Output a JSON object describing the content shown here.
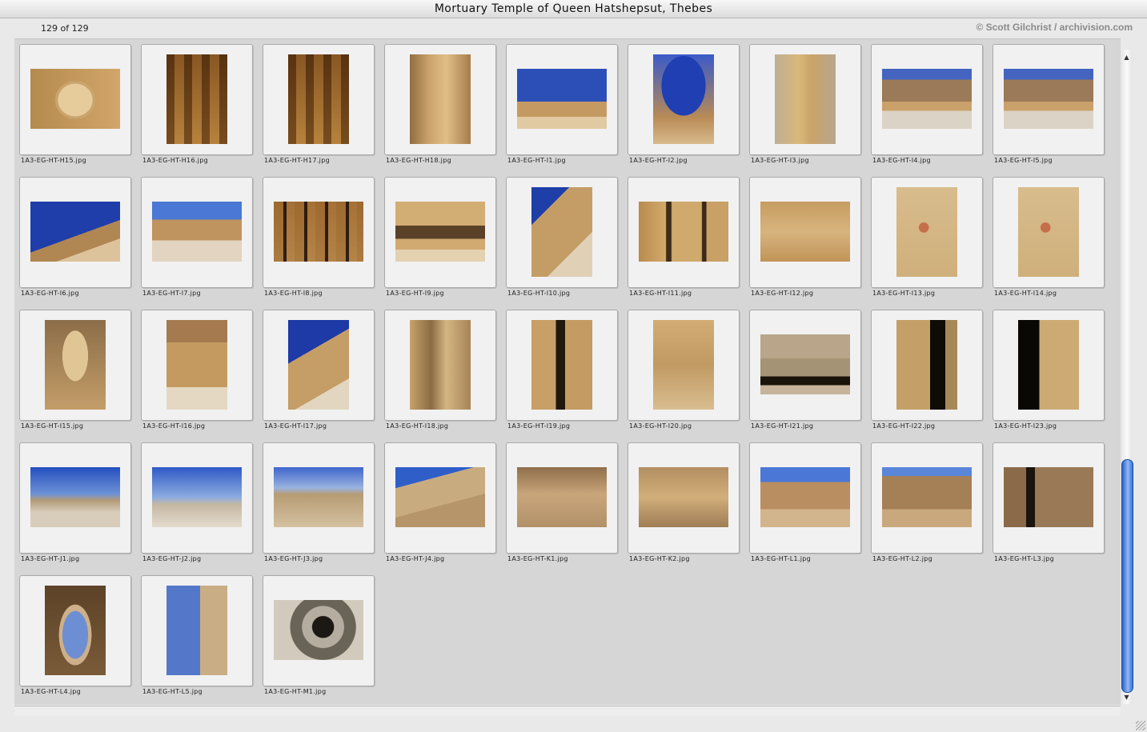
{
  "window": {
    "title": "Mortuary Temple of Queen Hatshepsut, Thebes"
  },
  "info": {
    "count": "129 of 129",
    "copyright": "© Scott Gilchrist / archivision.com"
  },
  "thumbnails": [
    {
      "file": "1A3-EG-HT-H15.jpg",
      "orient": "land",
      "look": "face"
    },
    {
      "file": "1A3-EG-HT-H16.jpg",
      "orient": "port",
      "look": "colonnade"
    },
    {
      "file": "1A3-EG-HT-H17.jpg",
      "orient": "port",
      "look": "colonnade"
    },
    {
      "file": "1A3-EG-HT-H18.jpg",
      "orient": "port",
      "look": "corridor"
    },
    {
      "file": "1A3-EG-HT-I1.jpg",
      "orient": "land",
      "look": "arch-sky"
    },
    {
      "file": "1A3-EG-HT-I2.jpg",
      "orient": "port",
      "look": "sky-round"
    },
    {
      "file": "1A3-EG-HT-I3.jpg",
      "orient": "port",
      "look": "shrine"
    },
    {
      "file": "1A3-EG-HT-I4.jpg",
      "orient": "land",
      "look": "terrace"
    },
    {
      "file": "1A3-EG-HT-I5.jpg",
      "orient": "land",
      "look": "terrace"
    },
    {
      "file": "1A3-EG-HT-I6.jpg",
      "orient": "land",
      "look": "sky-cliff"
    },
    {
      "file": "1A3-EG-HT-I7.jpg",
      "orient": "land",
      "look": "court"
    },
    {
      "file": "1A3-EG-HT-I8.jpg",
      "orient": "land",
      "look": "facade"
    },
    {
      "file": "1A3-EG-HT-I9.jpg",
      "orient": "land",
      "look": "facade2"
    },
    {
      "file": "1A3-EG-HT-I10.jpg",
      "orient": "port",
      "look": "tall-facade"
    },
    {
      "file": "1A3-EG-HT-I11.jpg",
      "orient": "land",
      "look": "wall"
    },
    {
      "file": "1A3-EG-HT-I12.jpg",
      "orient": "land",
      "look": "relief"
    },
    {
      "file": "1A3-EG-HT-I13.jpg",
      "orient": "port",
      "look": "relief2"
    },
    {
      "file": "1A3-EG-HT-I14.jpg",
      "orient": "port",
      "look": "relief2"
    },
    {
      "file": "1A3-EG-HT-I15.jpg",
      "orient": "port",
      "look": "statue"
    },
    {
      "file": "1A3-EG-HT-I16.jpg",
      "orient": "port",
      "look": "ruins-sky"
    },
    {
      "file": "1A3-EG-HT-I17.jpg",
      "orient": "port",
      "look": "ruins-blue"
    },
    {
      "file": "1A3-EG-HT-I18.jpg",
      "orient": "port",
      "look": "columns"
    },
    {
      "file": "1A3-EG-HT-I19.jpg",
      "orient": "port",
      "look": "doorway"
    },
    {
      "file": "1A3-EG-HT-I20.jpg",
      "orient": "port",
      "look": "capital"
    },
    {
      "file": "1A3-EG-HT-I21.jpg",
      "orient": "land",
      "look": "lintel"
    },
    {
      "file": "1A3-EG-HT-I22.jpg",
      "orient": "port",
      "look": "pillar-dark"
    },
    {
      "file": "1A3-EG-HT-I23.jpg",
      "orient": "port",
      "look": "pillar-dark2"
    },
    {
      "file": "1A3-EG-HT-J1.jpg",
      "orient": "land",
      "look": "plain"
    },
    {
      "file": "1A3-EG-HT-J2.jpg",
      "orient": "land",
      "look": "plain2"
    },
    {
      "file": "1A3-EG-HT-J3.jpg",
      "orient": "land",
      "look": "desert"
    },
    {
      "file": "1A3-EG-HT-J4.jpg",
      "orient": "land",
      "look": "hill"
    },
    {
      "file": "1A3-EG-HT-K1.jpg",
      "orient": "land",
      "look": "gorge"
    },
    {
      "file": "1A3-EG-HT-K2.jpg",
      "orient": "land",
      "look": "cliff"
    },
    {
      "file": "1A3-EG-HT-L1.jpg",
      "orient": "land",
      "look": "mountain"
    },
    {
      "file": "1A3-EG-HT-L2.jpg",
      "orient": "land",
      "look": "mountain2"
    },
    {
      "file": "1A3-EG-HT-L3.jpg",
      "orient": "land",
      "look": "gate"
    },
    {
      "file": "1A3-EG-HT-L4.jpg",
      "orient": "port",
      "look": "arch-view"
    },
    {
      "file": "1A3-EG-HT-L5.jpg",
      "orient": "port",
      "look": "obelisk"
    },
    {
      "file": "1A3-EG-HT-M1.jpg",
      "orient": "land",
      "look": "spiral"
    }
  ],
  "scrollbar": {
    "position": 0.98
  }
}
